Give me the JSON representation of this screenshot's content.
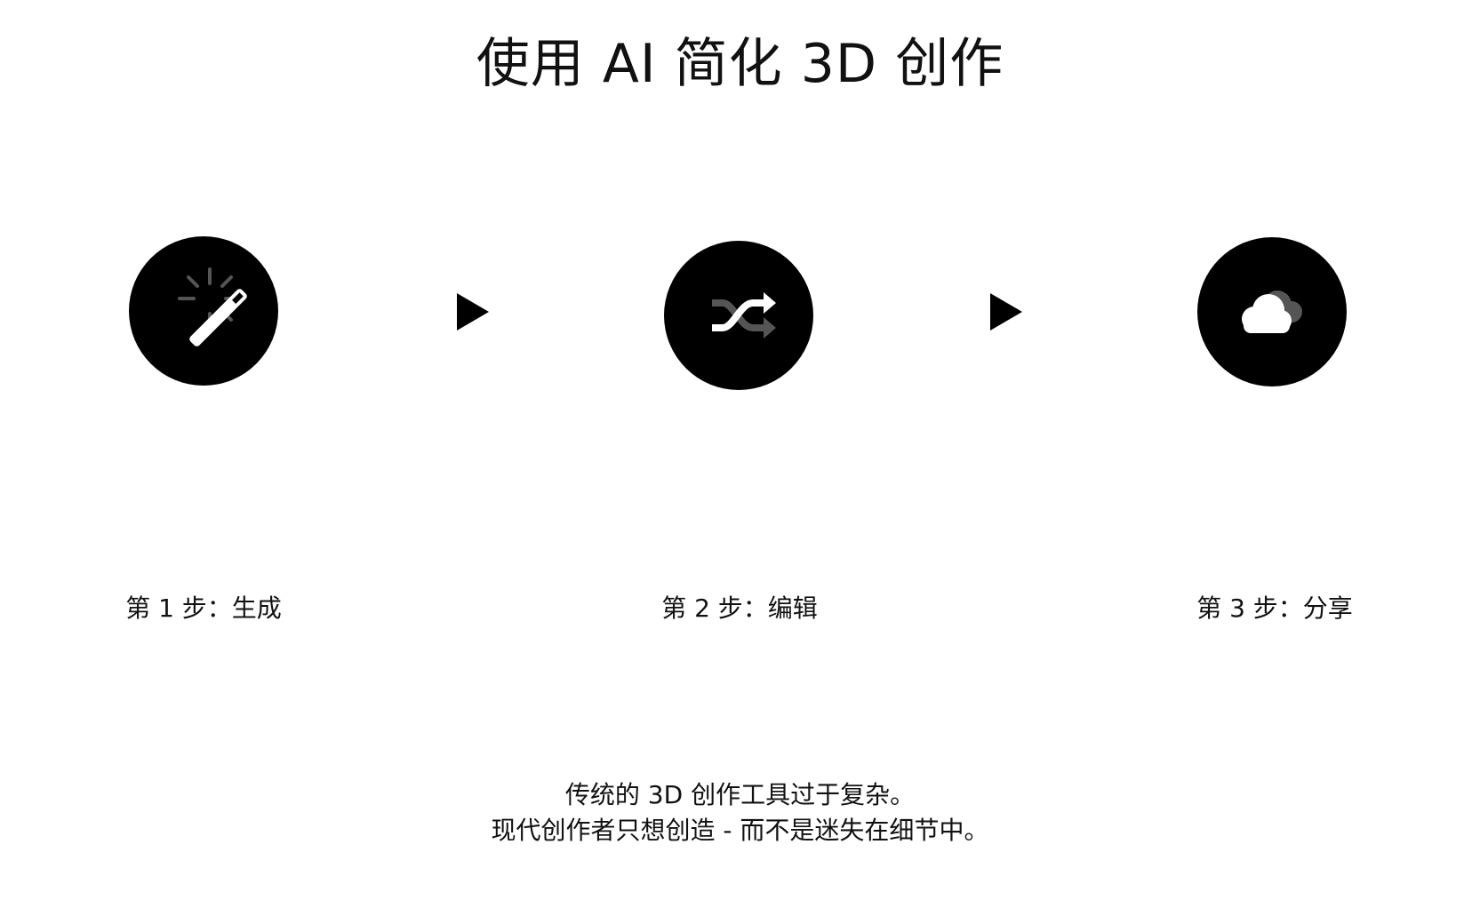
{
  "title": "使用 AI 简化 3D 创作",
  "steps": [
    {
      "label": "第 1 步：生成",
      "icon": "magic-wand-icon"
    },
    {
      "label": "第 2 步：编辑",
      "icon": "shuffle-icon"
    },
    {
      "label": "第 3 步：分享",
      "icon": "cloud-icon"
    }
  ],
  "arrow_icon": "play-triangle-icon",
  "description": {
    "line1": "传统的 3D 创作工具过于复杂。",
    "line2": "现代创作者只想创造 - 而不是迷失在细节中。"
  },
  "colors": {
    "background": "#ffffff",
    "circle": "#000000",
    "icon_primary": "#ffffff",
    "icon_secondary": "#555555",
    "text": "#111111"
  }
}
